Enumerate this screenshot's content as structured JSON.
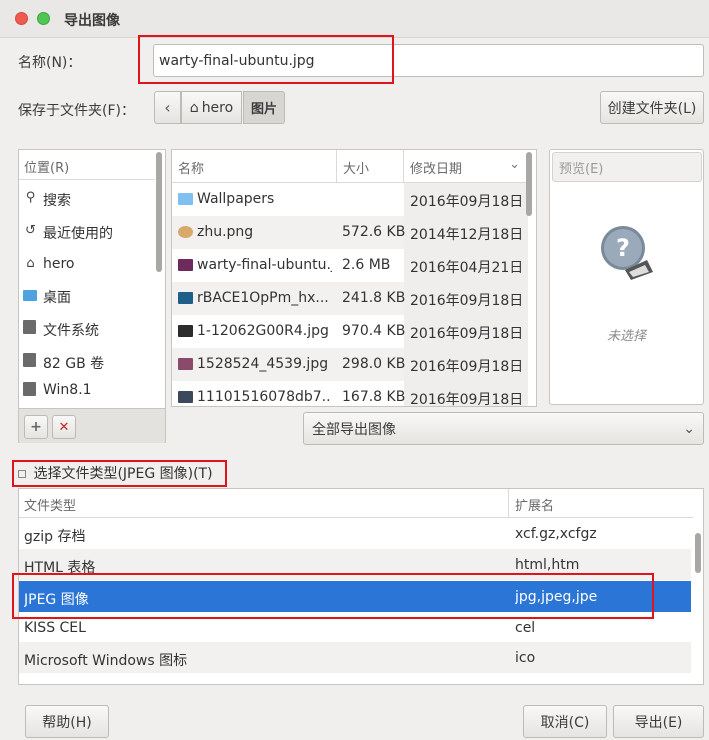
{
  "window": {
    "title": "导出图像"
  },
  "name_field": {
    "label": "名称(N)：",
    "value": "warty-final-ubuntu.jpg"
  },
  "folder": {
    "label": "保存于文件夹(F)：",
    "breadcrumbs": [
      "hero",
      "图片"
    ],
    "create_folder": "创建文件夹(L)"
  },
  "places": {
    "header": "位置(R)",
    "items": [
      {
        "label": "搜索",
        "icon": "search-icon"
      },
      {
        "label": "最近使用的",
        "icon": "recent-icon"
      },
      {
        "label": "hero",
        "icon": "home-icon"
      },
      {
        "label": "桌面",
        "icon": "desktop-icon"
      },
      {
        "label": "文件系统",
        "icon": "drive-icon"
      },
      {
        "label": "82 GB 卷",
        "icon": "drive-icon"
      },
      {
        "label": "Win8.1",
        "icon": "drive-icon"
      }
    ]
  },
  "files": {
    "columns": [
      "名称",
      "大小",
      "修改日期"
    ],
    "rows": [
      {
        "name": "Wallpapers",
        "size": "",
        "date": "2016年09月18日",
        "icon": "folder-icon"
      },
      {
        "name": "zhu.png",
        "size": "572.6 KB",
        "date": "2014年12月18日",
        "icon": "image-icon"
      },
      {
        "name": "warty-final-ubuntu.jpg",
        "size": "2.6 MB",
        "date": "2016年04月21日",
        "icon": "image-icon"
      },
      {
        "name": "rBACE1OpPm_hx...",
        "size": "241.8 KB",
        "date": "2016年09月18日",
        "icon": "image-icon"
      },
      {
        "name": "1-12062G00R4.jpg",
        "size": "970.4 KB",
        "date": "2016年09月18日",
        "icon": "image-icon"
      },
      {
        "name": "1528524_4539.jpg",
        "size": "298.0 KB",
        "date": "2016年09月18日",
        "icon": "image-icon"
      },
      {
        "name": "11101516078db7...",
        "size": "167.8 KB",
        "date": "2016年09月18日",
        "icon": "image-icon"
      }
    ]
  },
  "preview": {
    "label": "预览(E)",
    "none": "未选择"
  },
  "filter": {
    "value": "全部导出图像"
  },
  "filetype": {
    "toggle_label": "选择文件类型(JPEG 图像)(T)",
    "columns": [
      "文件类型",
      "扩展名"
    ],
    "rows": [
      {
        "type": "gzip 存档",
        "ext": "xcf.gz,xcfgz"
      },
      {
        "type": "HTML 表格",
        "ext": "html,htm"
      },
      {
        "type": "JPEG 图像",
        "ext": "jpg,jpeg,jpe"
      },
      {
        "type": "KISS CEL",
        "ext": "cel"
      },
      {
        "type": "Microsoft Windows 图标",
        "ext": "ico"
      }
    ],
    "selected_index": 2
  },
  "buttons": {
    "help": "帮助(H)",
    "cancel": "取消(C)",
    "export": "导出(E)"
  },
  "colors": {
    "selection": "#2a75d6",
    "highlight_box": "#e0141d"
  }
}
